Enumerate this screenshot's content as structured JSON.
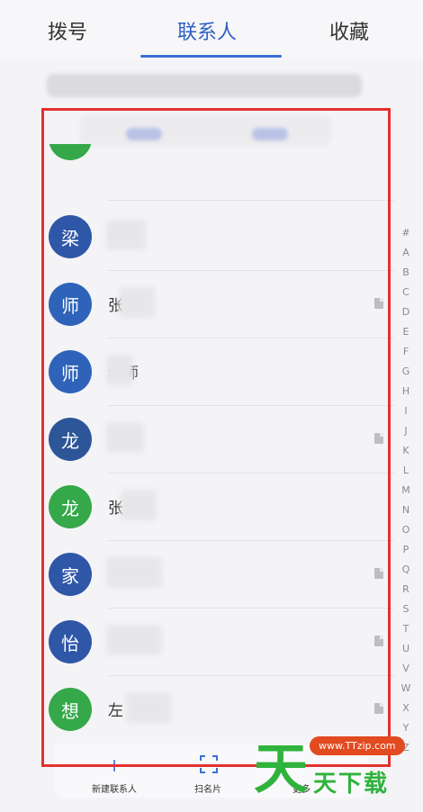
{
  "tabs": [
    {
      "label": "拨号"
    },
    {
      "label": "联系人"
    },
    {
      "label": "收藏"
    }
  ],
  "contacts": [
    {
      "avatar": "梁",
      "name": "张梁",
      "color": "#2f57a8",
      "has_doc": false
    },
    {
      "avatar": "师",
      "name": "张师",
      "color": "#2f63b9",
      "has_doc": true
    },
    {
      "avatar": "师",
      "name": "老师",
      "color": "#2f63b9",
      "has_doc": false
    },
    {
      "avatar": "龙",
      "name": "",
      "color": "#2d5699",
      "has_doc": true
    },
    {
      "avatar": "龙",
      "name": "张",
      "color": "#35a84a",
      "has_doc": false
    },
    {
      "avatar": "家",
      "name": "",
      "color": "#2f57a8",
      "has_doc": true
    },
    {
      "avatar": "怡",
      "name": "",
      "color": "#2f57a8",
      "has_doc": true
    },
    {
      "avatar": "想",
      "name": "左",
      "color": "#35a84a",
      "has_doc": true
    }
  ],
  "alphabet": [
    "#",
    "A",
    "B",
    "C",
    "D",
    "E",
    "F",
    "G",
    "H",
    "I",
    "J",
    "K",
    "L",
    "M",
    "N",
    "O",
    "P",
    "Q",
    "R",
    "S",
    "T",
    "U",
    "V",
    "W",
    "X",
    "Y",
    "Z"
  ],
  "bottom": {
    "new_contact": "新建联系人",
    "scan_card": "扫名片",
    "more": "更多"
  },
  "watermark": {
    "big": "天",
    "url": "www.TTzip.com",
    "small": "天下载"
  }
}
